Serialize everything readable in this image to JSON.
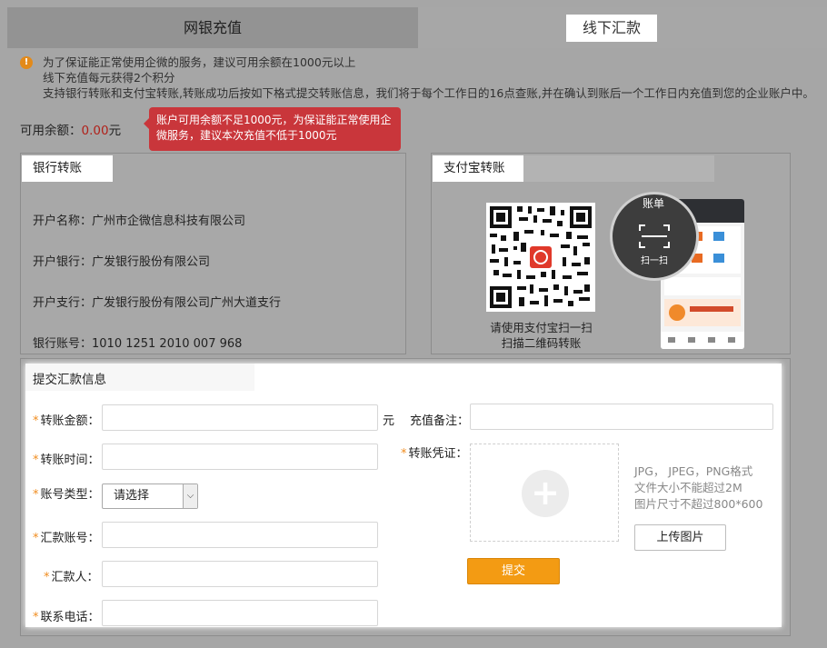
{
  "tabs": {
    "online": "网银充值",
    "offline": "线下汇款"
  },
  "notice": {
    "icon": "warning-icon",
    "lines": [
      "为了保证能正常使用企微的服务，建议可用余额在1000元以上",
      "线下充值每元获得2个积分",
      "支持银行转账和支付宝转账,转账成功后按如下格式提交转账信息，我们将于每个工作日的16点查账,并在确认到账后一个工作日内充值到您的企业账户中。"
    ]
  },
  "balance": {
    "label": "可用余额：",
    "amount": "0.00",
    "unit": "元",
    "tooltip": "账户可用余额不足1000元，为保证能正常使用企微服务，建议本次充值不低于1000元"
  },
  "bank": {
    "title": "银行转账",
    "rows": [
      "开户名称：广州市企微信息科技有限公司",
      "开户银行：广发银行股份有限公司",
      "开户支行：广发银行股份有限公司广州大道支行",
      "银行账号：1010 1251 2010 007 968"
    ]
  },
  "alipay": {
    "title": "支付宝转账",
    "caption_line1": "请使用支付宝扫一扫",
    "caption_line2": "扫描二维码转账",
    "bill_label": "账单",
    "scan_label": "扫一扫"
  },
  "form": {
    "title": "提交汇款信息",
    "amount_label": "转账金额：",
    "amount_unit": "元",
    "time_label": "转账时间：",
    "account_type_label": "账号类型：",
    "account_type_value": "请选择",
    "remit_account_label": "汇款账号：",
    "remitter_label": "汇款人：",
    "phone_label": "联系电话：",
    "remark_label": "充值备注：",
    "voucher_label": "转账凭证：",
    "hints": [
      "JPG， JPEG，PNG格式",
      "文件大小不能超过2M",
      "图片尺寸不超过800*600"
    ],
    "upload_button": "上传图片",
    "submit_button": "提交"
  },
  "colors": {
    "accent": "#f39b13",
    "tooltip": "#c9363b",
    "amount": "#b0211a",
    "required": "#f08c1f"
  }
}
